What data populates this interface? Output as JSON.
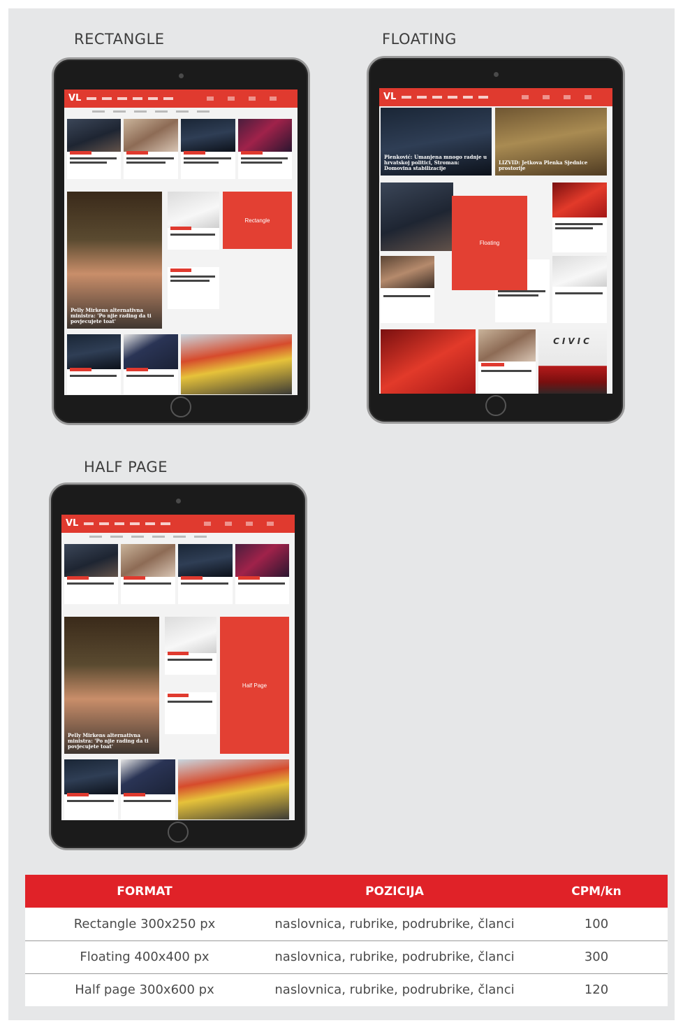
{
  "sections": {
    "rectangle": {
      "title": "RECTANGLE",
      "ad_label": "Rectangle",
      "hero_caption": "Pelly Mirkens alternativna ministra: 'Po njie rading da ti povjecujete toat'"
    },
    "floating": {
      "title": "FLOATING",
      "ad_label": "Floating",
      "top_caption_left": "Plenković: Umanjena mnogo radnje u hrvatskoj politici, Stroman: Domovina stabilizacije",
      "top_caption_right": "LIZVID: Jetkova Plenka Sjednice prostorije",
      "brand": "CIVIC"
    },
    "half_page": {
      "title": "HALF PAGE",
      "ad_label": "Half Page",
      "hero_caption": "Pelly Mirkens alternativna ministra: 'Po njie rading da ti povjecujete toat'"
    }
  },
  "site": {
    "logo": "VL"
  },
  "table": {
    "headers": [
      "FORMAT",
      "POZICIJA",
      "CPM/kn"
    ],
    "rows": [
      [
        "Rectangle 300x250 px",
        "naslovnica, rubrike, podrubrike, članci",
        "100"
      ],
      [
        "Floating 400x400 px",
        "naslovnica, rubrike, podrubrike, članci",
        "300"
      ],
      [
        "Half page 300x600 px",
        "naslovnica, rubrike, podrubrike, članci",
        "120"
      ]
    ]
  },
  "colors": {
    "accent": "#e02228",
    "ad_red": "#e34033",
    "panel_bg": "#e6e7e8",
    "site_red": "#e03a2f"
  }
}
